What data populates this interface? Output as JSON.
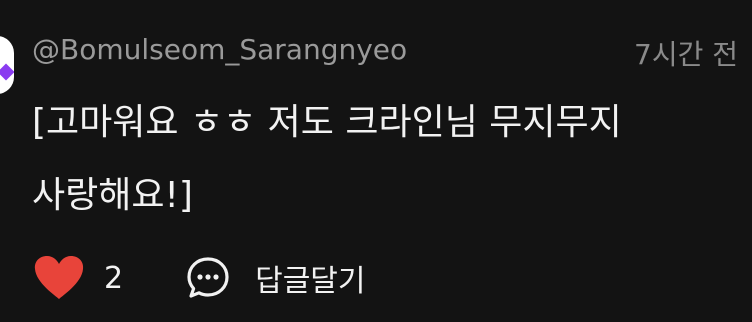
{
  "comment": {
    "username": "@Bomulseom_Sarangnyeo",
    "timestamp": "7시간 전",
    "text": "[고마워요 ㅎㅎ 저도 크라인님 무지무지 사랑해요!]"
  },
  "actions": {
    "like_count": "2",
    "reply_label": "답글달기"
  },
  "icons": {
    "like": "heart-icon",
    "reply": "chat-bubble-icon"
  },
  "colors": {
    "background": "#131313",
    "heart": "#e8443a",
    "avatar_accent": "#8a3cf0",
    "muted_text": "#9a9a9a",
    "body_text": "#f2f2f2"
  }
}
